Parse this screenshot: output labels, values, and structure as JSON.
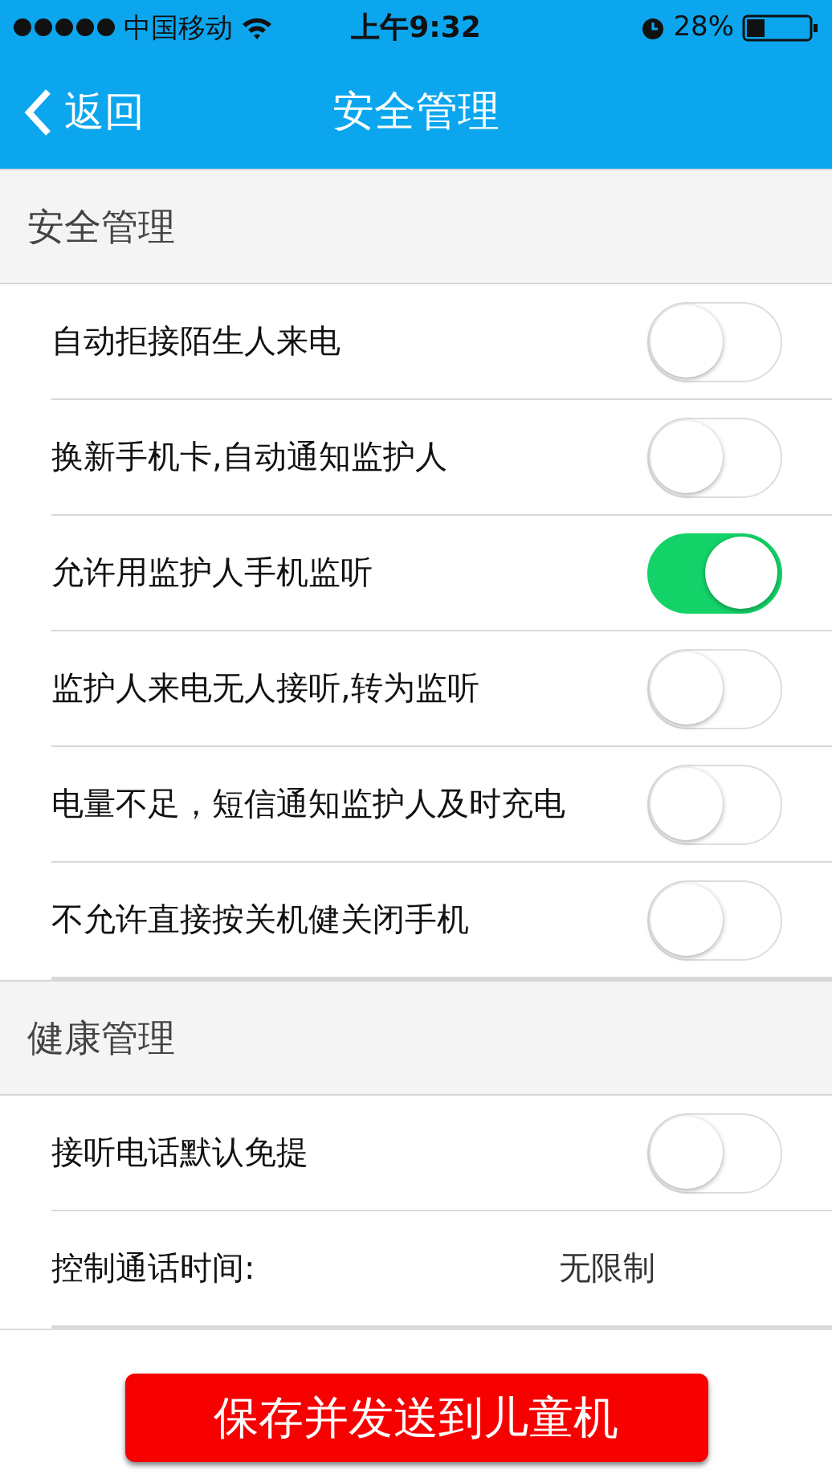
{
  "status_bar": {
    "carrier": "中国移动",
    "time": "上午9:32",
    "battery": "28%"
  },
  "nav": {
    "back": "返回",
    "title": "安全管理"
  },
  "sections": [
    {
      "title": "安全管理",
      "rows": [
        {
          "kind": "toggle",
          "label": "自动拒接陌生人来电",
          "on": false
        },
        {
          "kind": "toggle",
          "label": "换新手机卡,自动通知监护人",
          "on": false
        },
        {
          "kind": "toggle",
          "label": "允许用监护人手机监听",
          "on": true
        },
        {
          "kind": "toggle",
          "label": "监护人来电无人接听,转为监听",
          "on": false
        },
        {
          "kind": "toggle",
          "label": "电量不足，短信通知监护人及时充电",
          "on": false
        },
        {
          "kind": "toggle",
          "label": "不允许直接按关机健关闭手机",
          "on": false
        }
      ]
    },
    {
      "title": "健康管理",
      "rows": [
        {
          "kind": "toggle",
          "label": "接听电话默认免提",
          "on": false
        },
        {
          "kind": "value",
          "label": "控制通话时间:",
          "value": "无限制"
        }
      ]
    }
  ],
  "save_button": "保存并发送到儿童机"
}
